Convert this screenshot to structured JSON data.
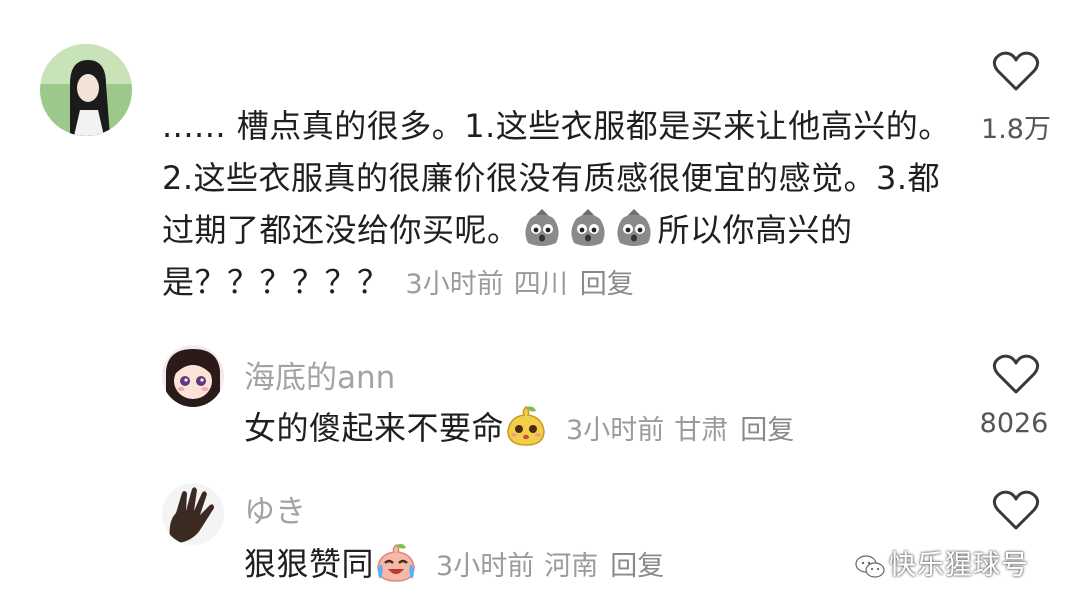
{
  "main_comment": {
    "avatar": "girl-long-black-hair-avatar",
    "text": "...... 槽点真的很多。1.这些衣服都是买来让他高兴的。2.这些衣服真的很廉价很没有质感很便宜的感觉。3.都过期了都还没给你买呢。",
    "emojis": [
      "scared-bag-emoji",
      "scared-bag-emoji",
      "scared-bag-emoji"
    ],
    "text_after": "所以你高兴的是？？？？？？",
    "time": "3小时前",
    "location": "四川",
    "reply_label": "回复",
    "likes": "1.8万"
  },
  "replies": [
    {
      "username": "海底的ann",
      "avatar": "anime-girl-avatar",
      "text": "女的傻起来不要命",
      "emoji": "pear-face-emoji",
      "time": "3小时前",
      "location": "甘肃",
      "reply_label": "回复",
      "likes": "8026"
    },
    {
      "username": "ゆき",
      "avatar": "hand-avatar",
      "text": "狠狠赞同",
      "emoji": "crying-laugh-emoji",
      "time": "3小时前",
      "location": "河南",
      "reply_label": "回复",
      "likes": ""
    }
  ],
  "watermark": "快乐猩球号",
  "colors": {
    "text": "#1f1f1f",
    "meta": "#9b9b9b",
    "username": "#a3a3a3",
    "background": "#ffffff"
  }
}
